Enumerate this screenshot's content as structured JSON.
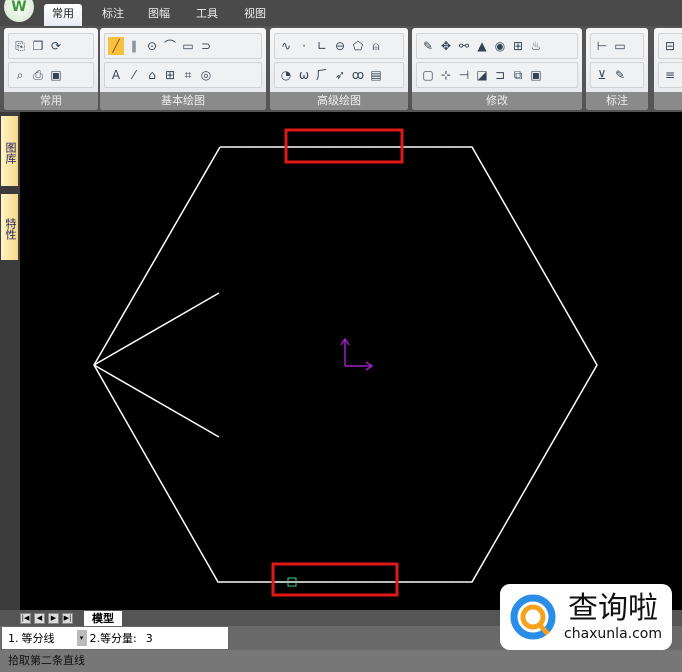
{
  "app": {
    "logo": "W"
  },
  "tabs": [
    {
      "label": "常用",
      "active": true
    },
    {
      "label": "标注"
    },
    {
      "label": "图幅"
    },
    {
      "label": "工具"
    },
    {
      "label": "视图"
    }
  ],
  "ribbon_groups": [
    {
      "label": "常用",
      "row1": [
        "⎘",
        "❐",
        "⟳"
      ],
      "row2": [
        "⌕",
        "⎙",
        "▣"
      ]
    },
    {
      "label": "基本绘图",
      "row1": [
        "╱",
        "∥",
        "⊙",
        "⌒",
        "▭",
        "⊃"
      ],
      "row2": [
        "A",
        "⁄",
        "⌂",
        "⊞",
        "⌗",
        "◎"
      ]
    },
    {
      "label": "高级绘图",
      "row1": [
        "∿",
        "·",
        "∟",
        "⊖",
        "⬠",
        "⍝"
      ],
      "row2": [
        "◔",
        "ω",
        "⺁",
        "➶",
        "ꝏ",
        "▤"
      ]
    },
    {
      "label": "修改",
      "row1": [
        "✎",
        "✥",
        "⚯",
        "▲",
        "◉",
        "⊞",
        "♨"
      ],
      "row2": [
        "▢",
        "⊹",
        "⊣",
        "◪",
        "⊐",
        "⧉",
        "▣"
      ]
    },
    {
      "label": "标注",
      "row1": [
        "⊢",
        "▭"
      ],
      "row2": [
        "⊻",
        "✎"
      ]
    },
    {
      "label": "",
      "row1": [
        "⊟"
      ],
      "row2": [
        "≡"
      ]
    }
  ],
  "side_tabs": [
    "图库",
    "特性"
  ],
  "model_tab": "模型",
  "command": {
    "opt1_num": "1.",
    "opt1_value": "等分线",
    "opt2_label": "2.等分量:",
    "opt2_value": "3"
  },
  "status_text": "拾取第二条直线",
  "watermark": {
    "title": "查询啦",
    "url": "chaxunla.com"
  },
  "colors": {
    "highlight": "#e01818",
    "ucs": "#a020c0",
    "lines": "#ffffff"
  }
}
